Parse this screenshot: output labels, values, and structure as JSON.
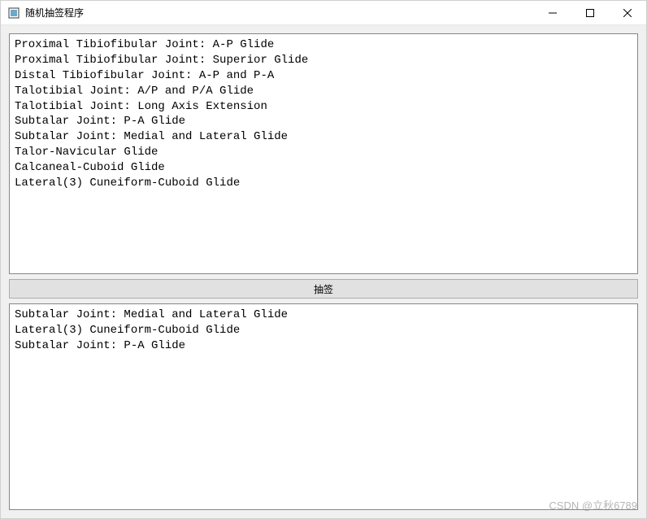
{
  "window": {
    "title": "随机抽签程序"
  },
  "upperList": {
    "items": [
      "Proximal Tibiofibular Joint: A-P Glide",
      "Proximal Tibiofibular Joint: Superior Glide",
      "Distal Tibiofibular Joint: A-P and P-A",
      "Talotibial Joint: A/P and P/A Glide",
      "Talotibial Joint: Long Axis Extension",
      "Subtalar Joint: P-A Glide",
      "Subtalar Joint: Medial and Lateral Glide",
      "Talor-Navicular Glide",
      "Calcaneal-Cuboid Glide",
      "Lateral(3) Cuneiform-Cuboid Glide"
    ]
  },
  "button": {
    "label": "抽签"
  },
  "lowerList": {
    "items": [
      "Subtalar Joint: Medial and Lateral Glide",
      "Lateral(3) Cuneiform-Cuboid Glide",
      "Subtalar Joint: P-A Glide"
    ]
  },
  "watermark": "CSDN @立秋6789"
}
